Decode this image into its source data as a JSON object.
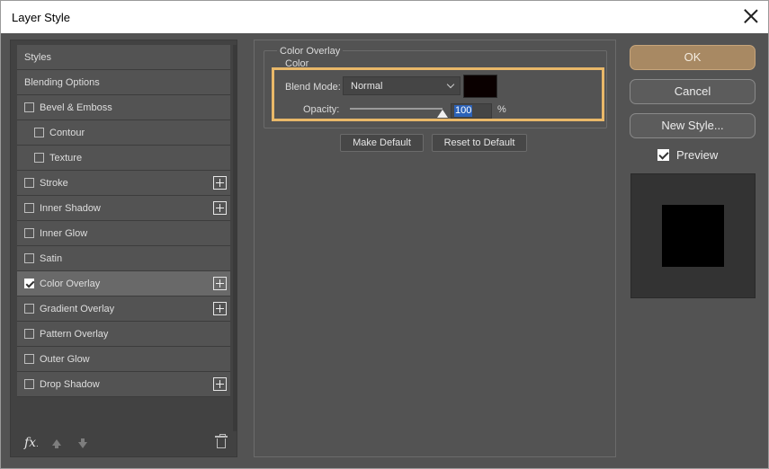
{
  "window": {
    "title": "Layer Style"
  },
  "styles_panel": {
    "items": [
      {
        "label": "Styles",
        "checkbox": false,
        "checked": false,
        "plus": false,
        "indent": 0,
        "selected": false
      },
      {
        "label": "Blending Options",
        "checkbox": false,
        "checked": false,
        "plus": false,
        "indent": 0,
        "selected": false
      },
      {
        "label": "Bevel & Emboss",
        "checkbox": true,
        "checked": false,
        "plus": false,
        "indent": 0,
        "selected": false
      },
      {
        "label": "Contour",
        "checkbox": true,
        "checked": false,
        "plus": false,
        "indent": 1,
        "selected": false
      },
      {
        "label": "Texture",
        "checkbox": true,
        "checked": false,
        "plus": false,
        "indent": 1,
        "selected": false
      },
      {
        "label": "Stroke",
        "checkbox": true,
        "checked": false,
        "plus": true,
        "indent": 0,
        "selected": false
      },
      {
        "label": "Inner Shadow",
        "checkbox": true,
        "checked": false,
        "plus": true,
        "indent": 0,
        "selected": false
      },
      {
        "label": "Inner Glow",
        "checkbox": true,
        "checked": false,
        "plus": false,
        "indent": 0,
        "selected": false
      },
      {
        "label": "Satin",
        "checkbox": true,
        "checked": false,
        "plus": false,
        "indent": 0,
        "selected": false
      },
      {
        "label": "Color Overlay",
        "checkbox": true,
        "checked": true,
        "plus": true,
        "indent": 0,
        "selected": true
      },
      {
        "label": "Gradient Overlay",
        "checkbox": true,
        "checked": false,
        "plus": true,
        "indent": 0,
        "selected": false
      },
      {
        "label": "Pattern Overlay",
        "checkbox": true,
        "checked": false,
        "plus": false,
        "indent": 0,
        "selected": false
      },
      {
        "label": "Outer Glow",
        "checkbox": true,
        "checked": false,
        "plus": false,
        "indent": 0,
        "selected": false
      },
      {
        "label": "Drop Shadow",
        "checkbox": true,
        "checked": false,
        "plus": true,
        "indent": 0,
        "selected": false
      }
    ],
    "footer": {
      "fx_label": "fx"
    }
  },
  "color_overlay": {
    "legend": "Color Overlay",
    "sublegend": "Color",
    "blend_mode_label": "Blend Mode:",
    "blend_mode_value": "Normal",
    "swatch_color": "#0a0000",
    "opacity_label": "Opacity:",
    "opacity_value": "100",
    "opacity_fraction": 1.0,
    "opacity_unit": "%",
    "make_default_label": "Make Default",
    "reset_default_label": "Reset to Default"
  },
  "actions": {
    "ok_label": "OK",
    "cancel_label": "Cancel",
    "new_style_label": "New Style...",
    "preview_label": "Preview",
    "preview_checked": true,
    "preview_fill_color": "#000000"
  },
  "colors": {
    "panel_bg": "#535353",
    "ok_accent": "#a88963",
    "highlight_border": "#e9b869",
    "selection_blue": "#2c62b8"
  }
}
